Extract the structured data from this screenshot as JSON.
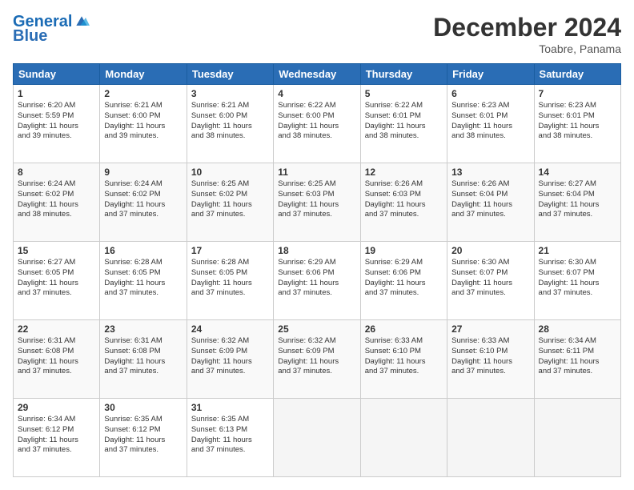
{
  "logo": {
    "line1": "General",
    "line2": "Blue"
  },
  "title": "December 2024",
  "location": "Toabre, Panama",
  "days_header": [
    "Sunday",
    "Monday",
    "Tuesday",
    "Wednesday",
    "Thursday",
    "Friday",
    "Saturday"
  ],
  "weeks": [
    [
      {
        "day": 1,
        "info": "Sunrise: 6:20 AM\nSunset: 5:59 PM\nDaylight: 11 hours\nand 39 minutes."
      },
      {
        "day": 2,
        "info": "Sunrise: 6:21 AM\nSunset: 6:00 PM\nDaylight: 11 hours\nand 39 minutes."
      },
      {
        "day": 3,
        "info": "Sunrise: 6:21 AM\nSunset: 6:00 PM\nDaylight: 11 hours\nand 38 minutes."
      },
      {
        "day": 4,
        "info": "Sunrise: 6:22 AM\nSunset: 6:00 PM\nDaylight: 11 hours\nand 38 minutes."
      },
      {
        "day": 5,
        "info": "Sunrise: 6:22 AM\nSunset: 6:01 PM\nDaylight: 11 hours\nand 38 minutes."
      },
      {
        "day": 6,
        "info": "Sunrise: 6:23 AM\nSunset: 6:01 PM\nDaylight: 11 hours\nand 38 minutes."
      },
      {
        "day": 7,
        "info": "Sunrise: 6:23 AM\nSunset: 6:01 PM\nDaylight: 11 hours\nand 38 minutes."
      }
    ],
    [
      {
        "day": 8,
        "info": "Sunrise: 6:24 AM\nSunset: 6:02 PM\nDaylight: 11 hours\nand 38 minutes."
      },
      {
        "day": 9,
        "info": "Sunrise: 6:24 AM\nSunset: 6:02 PM\nDaylight: 11 hours\nand 37 minutes."
      },
      {
        "day": 10,
        "info": "Sunrise: 6:25 AM\nSunset: 6:02 PM\nDaylight: 11 hours\nand 37 minutes."
      },
      {
        "day": 11,
        "info": "Sunrise: 6:25 AM\nSunset: 6:03 PM\nDaylight: 11 hours\nand 37 minutes."
      },
      {
        "day": 12,
        "info": "Sunrise: 6:26 AM\nSunset: 6:03 PM\nDaylight: 11 hours\nand 37 minutes."
      },
      {
        "day": 13,
        "info": "Sunrise: 6:26 AM\nSunset: 6:04 PM\nDaylight: 11 hours\nand 37 minutes."
      },
      {
        "day": 14,
        "info": "Sunrise: 6:27 AM\nSunset: 6:04 PM\nDaylight: 11 hours\nand 37 minutes."
      }
    ],
    [
      {
        "day": 15,
        "info": "Sunrise: 6:27 AM\nSunset: 6:05 PM\nDaylight: 11 hours\nand 37 minutes."
      },
      {
        "day": 16,
        "info": "Sunrise: 6:28 AM\nSunset: 6:05 PM\nDaylight: 11 hours\nand 37 minutes."
      },
      {
        "day": 17,
        "info": "Sunrise: 6:28 AM\nSunset: 6:05 PM\nDaylight: 11 hours\nand 37 minutes."
      },
      {
        "day": 18,
        "info": "Sunrise: 6:29 AM\nSunset: 6:06 PM\nDaylight: 11 hours\nand 37 minutes."
      },
      {
        "day": 19,
        "info": "Sunrise: 6:29 AM\nSunset: 6:06 PM\nDaylight: 11 hours\nand 37 minutes."
      },
      {
        "day": 20,
        "info": "Sunrise: 6:30 AM\nSunset: 6:07 PM\nDaylight: 11 hours\nand 37 minutes."
      },
      {
        "day": 21,
        "info": "Sunrise: 6:30 AM\nSunset: 6:07 PM\nDaylight: 11 hours\nand 37 minutes."
      }
    ],
    [
      {
        "day": 22,
        "info": "Sunrise: 6:31 AM\nSunset: 6:08 PM\nDaylight: 11 hours\nand 37 minutes."
      },
      {
        "day": 23,
        "info": "Sunrise: 6:31 AM\nSunset: 6:08 PM\nDaylight: 11 hours\nand 37 minutes."
      },
      {
        "day": 24,
        "info": "Sunrise: 6:32 AM\nSunset: 6:09 PM\nDaylight: 11 hours\nand 37 minutes."
      },
      {
        "day": 25,
        "info": "Sunrise: 6:32 AM\nSunset: 6:09 PM\nDaylight: 11 hours\nand 37 minutes."
      },
      {
        "day": 26,
        "info": "Sunrise: 6:33 AM\nSunset: 6:10 PM\nDaylight: 11 hours\nand 37 minutes."
      },
      {
        "day": 27,
        "info": "Sunrise: 6:33 AM\nSunset: 6:10 PM\nDaylight: 11 hours\nand 37 minutes."
      },
      {
        "day": 28,
        "info": "Sunrise: 6:34 AM\nSunset: 6:11 PM\nDaylight: 11 hours\nand 37 minutes."
      }
    ],
    [
      {
        "day": 29,
        "info": "Sunrise: 6:34 AM\nSunset: 6:12 PM\nDaylight: 11 hours\nand 37 minutes."
      },
      {
        "day": 30,
        "info": "Sunrise: 6:35 AM\nSunset: 6:12 PM\nDaylight: 11 hours\nand 37 minutes."
      },
      {
        "day": 31,
        "info": "Sunrise: 6:35 AM\nSunset: 6:13 PM\nDaylight: 11 hours\nand 37 minutes."
      },
      null,
      null,
      null,
      null
    ]
  ]
}
